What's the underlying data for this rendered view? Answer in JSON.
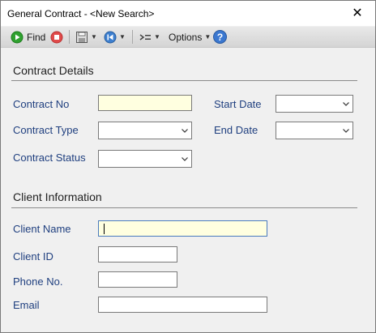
{
  "window": {
    "title": "General Contract - <New Search>",
    "close_label": "✕"
  },
  "toolbar": {
    "find_label": "Find",
    "options_label": "Options",
    "colors": {
      "find_green": "#2fa12f",
      "stop_red": "#e04a4a",
      "nav_blue": "#3d7fcf",
      "help_blue": "#3b78d0"
    }
  },
  "sections": {
    "contract_details": "Contract Details",
    "client_information": "Client Information"
  },
  "fields": {
    "contract_no": {
      "label": "Contract No",
      "value": ""
    },
    "start_date": {
      "label": "Start Date",
      "value": ""
    },
    "contract_type": {
      "label": "Contract Type",
      "value": ""
    },
    "end_date": {
      "label": "End Date",
      "value": ""
    },
    "contract_status": {
      "label": "Contract Status",
      "value": ""
    },
    "client_name": {
      "label": "Client Name",
      "value": ""
    },
    "client_id": {
      "label": "Client ID",
      "value": ""
    },
    "phone_no": {
      "label": "Phone No.",
      "value": ""
    },
    "email": {
      "label": "Email",
      "value": ""
    }
  },
  "colors": {
    "label_text": "#1f3f7f",
    "highlight_field": "#ffffe0"
  }
}
